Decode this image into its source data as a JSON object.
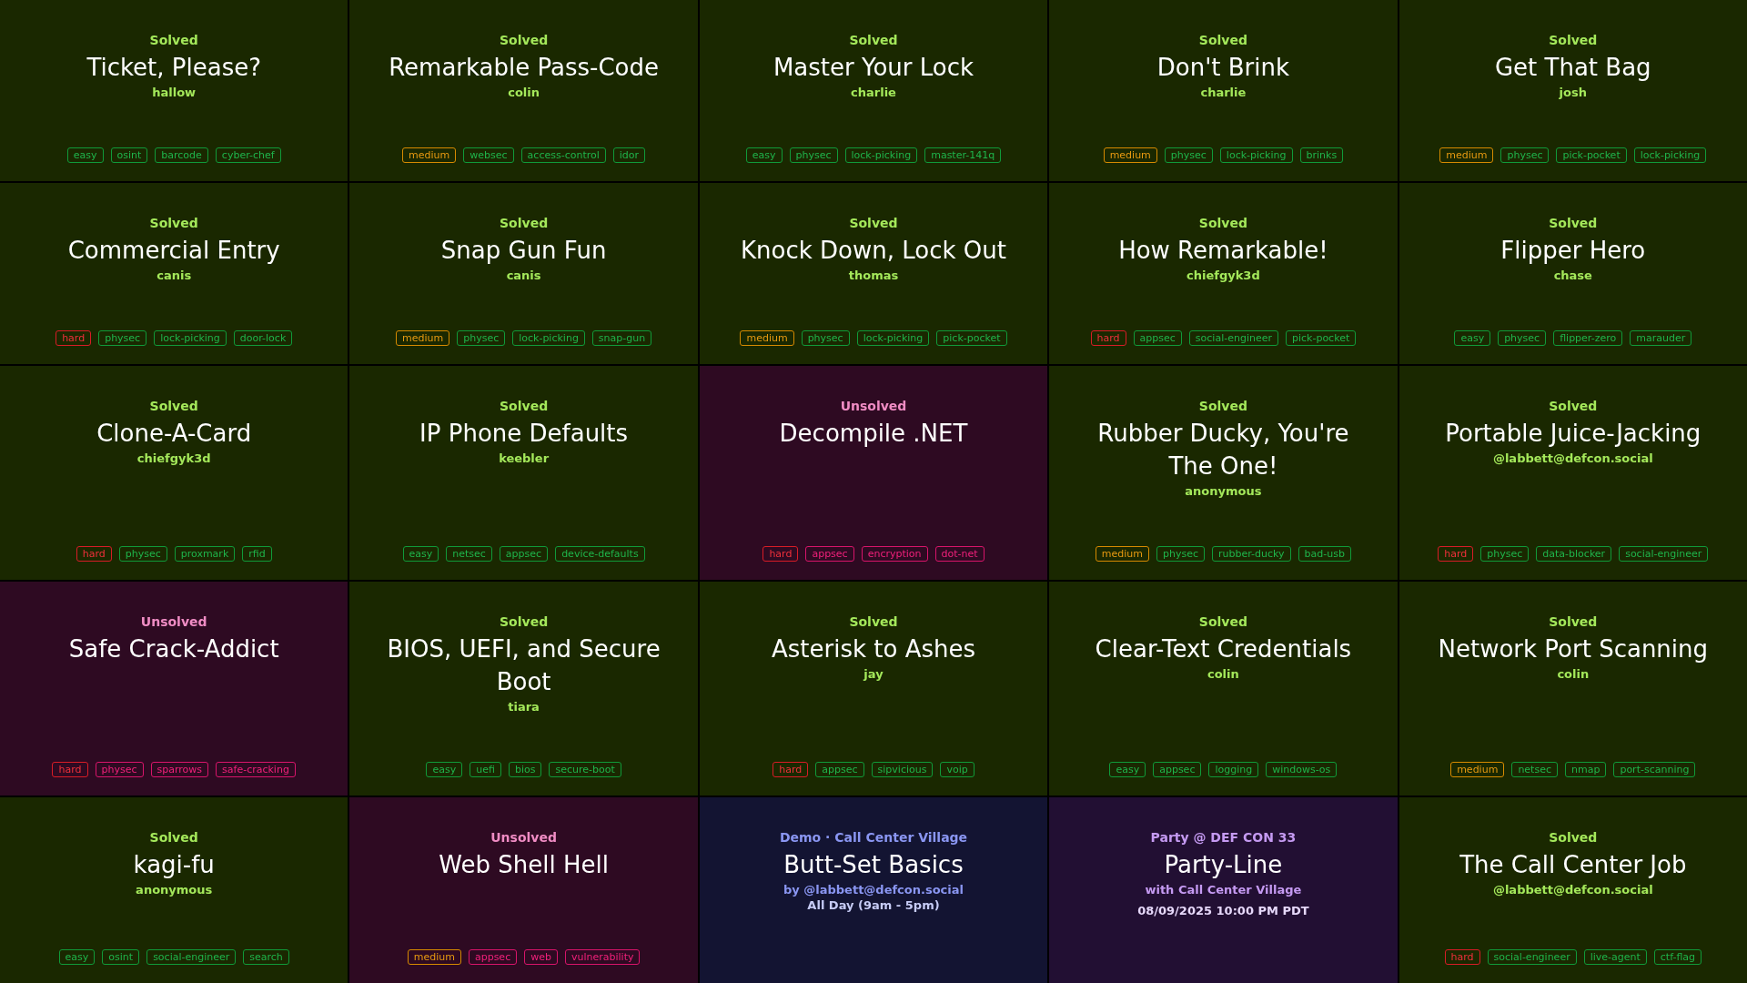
{
  "cards": [
    {
      "kind": "challenge",
      "solved": true,
      "status": "Solved",
      "title": "Ticket, Please?",
      "author": "hallow",
      "tags": [
        {
          "label": "easy",
          "kind": "easy"
        },
        {
          "label": "osint",
          "kind": "topic"
        },
        {
          "label": "barcode",
          "kind": "topic"
        },
        {
          "label": "cyber-chef",
          "kind": "topic"
        }
      ]
    },
    {
      "kind": "challenge",
      "solved": true,
      "status": "Solved",
      "title": "Remarkable Pass-Code",
      "author": "colin",
      "tags": [
        {
          "label": "medium",
          "kind": "medium"
        },
        {
          "label": "websec",
          "kind": "topic"
        },
        {
          "label": "access-control",
          "kind": "topic"
        },
        {
          "label": "idor",
          "kind": "topic"
        }
      ]
    },
    {
      "kind": "challenge",
      "solved": true,
      "status": "Solved",
      "title": "Master Your Lock",
      "author": "charlie",
      "tags": [
        {
          "label": "easy",
          "kind": "easy"
        },
        {
          "label": "physec",
          "kind": "topic"
        },
        {
          "label": "lock-picking",
          "kind": "topic"
        },
        {
          "label": "master-141q",
          "kind": "topic"
        }
      ]
    },
    {
      "kind": "challenge",
      "solved": true,
      "status": "Solved",
      "title": "Don't Brink",
      "author": "charlie",
      "tags": [
        {
          "label": "medium",
          "kind": "medium"
        },
        {
          "label": "physec",
          "kind": "topic"
        },
        {
          "label": "lock-picking",
          "kind": "topic"
        },
        {
          "label": "brinks",
          "kind": "topic"
        }
      ]
    },
    {
      "kind": "challenge",
      "solved": true,
      "status": "Solved",
      "title": "Get That Bag",
      "author": "josh",
      "tags": [
        {
          "label": "medium",
          "kind": "medium"
        },
        {
          "label": "physec",
          "kind": "topic"
        },
        {
          "label": "pick-pocket",
          "kind": "topic"
        },
        {
          "label": "lock-picking",
          "kind": "topic"
        }
      ]
    },
    {
      "kind": "challenge",
      "solved": true,
      "status": "Solved",
      "title": "Commercial Entry",
      "author": "canis",
      "tags": [
        {
          "label": "hard",
          "kind": "hard"
        },
        {
          "label": "physec",
          "kind": "topic"
        },
        {
          "label": "lock-picking",
          "kind": "topic"
        },
        {
          "label": "door-lock",
          "kind": "topic"
        }
      ]
    },
    {
      "kind": "challenge",
      "solved": true,
      "status": "Solved",
      "title": "Snap Gun Fun",
      "author": "canis",
      "tags": [
        {
          "label": "medium",
          "kind": "medium"
        },
        {
          "label": "physec",
          "kind": "topic"
        },
        {
          "label": "lock-picking",
          "kind": "topic"
        },
        {
          "label": "snap-gun",
          "kind": "topic"
        }
      ]
    },
    {
      "kind": "challenge",
      "solved": true,
      "status": "Solved",
      "title": "Knock Down, Lock Out",
      "author": "thomas",
      "tags": [
        {
          "label": "medium",
          "kind": "medium"
        },
        {
          "label": "physec",
          "kind": "topic"
        },
        {
          "label": "lock-picking",
          "kind": "topic"
        },
        {
          "label": "pick-pocket",
          "kind": "topic"
        }
      ]
    },
    {
      "kind": "challenge",
      "solved": true,
      "status": "Solved",
      "title": "How Remarkable!",
      "author": "chiefgyk3d",
      "tags": [
        {
          "label": "hard",
          "kind": "hard"
        },
        {
          "label": "appsec",
          "kind": "topic"
        },
        {
          "label": "social-engineer",
          "kind": "topic"
        },
        {
          "label": "pick-pocket",
          "kind": "topic"
        }
      ]
    },
    {
      "kind": "challenge",
      "solved": true,
      "status": "Solved",
      "title": "Flipper Hero",
      "author": "chase",
      "tags": [
        {
          "label": "easy",
          "kind": "easy"
        },
        {
          "label": "physec",
          "kind": "topic"
        },
        {
          "label": "flipper-zero",
          "kind": "topic"
        },
        {
          "label": "marauder",
          "kind": "topic"
        }
      ]
    },
    {
      "kind": "challenge",
      "solved": true,
      "status": "Solved",
      "title": "Clone-A-Card",
      "author": "chiefgyk3d",
      "tags": [
        {
          "label": "hard",
          "kind": "hard"
        },
        {
          "label": "physec",
          "kind": "topic"
        },
        {
          "label": "proxmark",
          "kind": "topic"
        },
        {
          "label": "rfid",
          "kind": "topic"
        }
      ]
    },
    {
      "kind": "challenge",
      "solved": true,
      "status": "Solved",
      "title": "IP Phone Defaults",
      "author": "keebler",
      "tags": [
        {
          "label": "easy",
          "kind": "easy"
        },
        {
          "label": "netsec",
          "kind": "topic"
        },
        {
          "label": "appsec",
          "kind": "topic"
        },
        {
          "label": "device-defaults",
          "kind": "topic"
        }
      ]
    },
    {
      "kind": "challenge",
      "solved": false,
      "status": "Unsolved",
      "title": "Decompile .NET",
      "tags": [
        {
          "label": "hard",
          "kind": "hard"
        },
        {
          "label": "appsec",
          "kind": "topic"
        },
        {
          "label": "encryption",
          "kind": "topic"
        },
        {
          "label": "dot-net",
          "kind": "topic"
        }
      ]
    },
    {
      "kind": "challenge",
      "solved": true,
      "status": "Solved",
      "title": "Rubber Ducky, You're The One!",
      "author": "anonymous",
      "tags": [
        {
          "label": "medium",
          "kind": "medium"
        },
        {
          "label": "physec",
          "kind": "topic"
        },
        {
          "label": "rubber-ducky",
          "kind": "topic"
        },
        {
          "label": "bad-usb",
          "kind": "topic"
        }
      ]
    },
    {
      "kind": "challenge",
      "solved": true,
      "status": "Solved",
      "title": "Portable Juice-Jacking",
      "author": "@labbett@defcon.social",
      "tags": [
        {
          "label": "hard",
          "kind": "hard"
        },
        {
          "label": "physec",
          "kind": "topic"
        },
        {
          "label": "data-blocker",
          "kind": "topic"
        },
        {
          "label": "social-engineer",
          "kind": "topic"
        }
      ]
    },
    {
      "kind": "challenge",
      "solved": false,
      "status": "Unsolved",
      "title": "Safe Crack-Addict",
      "tags": [
        {
          "label": "hard",
          "kind": "hard"
        },
        {
          "label": "physec",
          "kind": "topic"
        },
        {
          "label": "sparrows",
          "kind": "topic"
        },
        {
          "label": "safe-cracking",
          "kind": "topic"
        }
      ]
    },
    {
      "kind": "challenge",
      "solved": true,
      "status": "Solved",
      "title": "BIOS, UEFI, and Secure Boot",
      "author": "tiara",
      "tags": [
        {
          "label": "easy",
          "kind": "easy"
        },
        {
          "label": "uefi",
          "kind": "topic"
        },
        {
          "label": "bios",
          "kind": "topic"
        },
        {
          "label": "secure-boot",
          "kind": "topic"
        }
      ]
    },
    {
      "kind": "challenge",
      "solved": true,
      "status": "Solved",
      "title": "Asterisk to Ashes",
      "author": "jay",
      "tags": [
        {
          "label": "hard",
          "kind": "hard"
        },
        {
          "label": "appsec",
          "kind": "topic"
        },
        {
          "label": "sipvicious",
          "kind": "topic"
        },
        {
          "label": "voip",
          "kind": "topic"
        }
      ]
    },
    {
      "kind": "challenge",
      "solved": true,
      "status": "Solved",
      "title": "Clear-Text Credentials",
      "author": "colin",
      "tags": [
        {
          "label": "easy",
          "kind": "easy"
        },
        {
          "label": "appsec",
          "kind": "topic"
        },
        {
          "label": "logging",
          "kind": "topic"
        },
        {
          "label": "windows-os",
          "kind": "topic"
        }
      ]
    },
    {
      "kind": "challenge",
      "solved": true,
      "status": "Solved",
      "title": "Network Port Scanning",
      "author": "colin",
      "tags": [
        {
          "label": "medium",
          "kind": "medium"
        },
        {
          "label": "netsec",
          "kind": "topic"
        },
        {
          "label": "nmap",
          "kind": "topic"
        },
        {
          "label": "port-scanning",
          "kind": "topic"
        }
      ]
    },
    {
      "kind": "challenge",
      "solved": true,
      "status": "Solved",
      "title": "kagi-fu",
      "author": "anonymous",
      "tags": [
        {
          "label": "easy",
          "kind": "easy"
        },
        {
          "label": "osint",
          "kind": "topic"
        },
        {
          "label": "social-engineer",
          "kind": "topic"
        },
        {
          "label": "search",
          "kind": "topic"
        }
      ]
    },
    {
      "kind": "challenge",
      "solved": false,
      "status": "Unsolved",
      "title": "Web Shell Hell",
      "tags": [
        {
          "label": "medium",
          "kind": "medium"
        },
        {
          "label": "appsec",
          "kind": "topic"
        },
        {
          "label": "web",
          "kind": "topic"
        },
        {
          "label": "vulnerability",
          "kind": "topic"
        }
      ]
    },
    {
      "kind": "demo",
      "header": "Demo · Call Center Village",
      "title": "Butt-Set Basics",
      "byline": "by @labbett@defcon.social",
      "time": "All Day (9am - 5pm)"
    },
    {
      "kind": "party",
      "header": "Party @ DEF CON 33",
      "title": "Party-Line",
      "byline": "with Call Center Village",
      "time": "08/09/2025 10:00 PM PDT"
    },
    {
      "kind": "challenge",
      "solved": true,
      "status": "Solved",
      "title": "The Call Center Job",
      "author": "@labbett@defcon.social",
      "tags": [
        {
          "label": "hard",
          "kind": "hard"
        },
        {
          "label": "social-engineer",
          "kind": "topic"
        },
        {
          "label": "live-agent",
          "kind": "topic"
        },
        {
          "label": "ctf-flag",
          "kind": "topic"
        }
      ]
    }
  ]
}
